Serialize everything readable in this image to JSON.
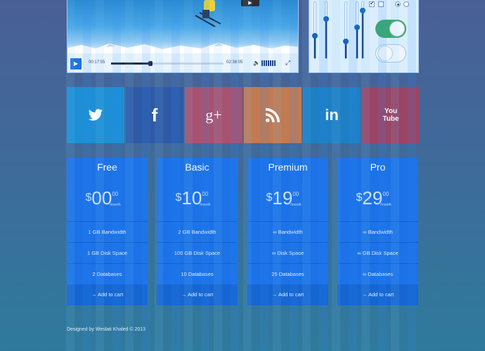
{
  "video": {
    "current_time": "00:17:55",
    "total_time": "02:38:05",
    "progress": 0.35,
    "play_glyph": "▶",
    "top_button_glyph": "▶",
    "volume_glyph": "🔈",
    "expand_glyph": "⤢"
  },
  "controls": {
    "checkbox_glyph": "✔",
    "sliders": [
      0.4,
      0.7,
      0.3,
      0.55,
      0.85
    ],
    "checkbox_checked": true,
    "radio_selected": true,
    "toggle_on": true,
    "toggle_off": false
  },
  "social": [
    {
      "name": "twitter",
      "color": "#1e8fd4",
      "glyph": "🐦"
    },
    {
      "name": "facebook",
      "color": "#2f5aa6",
      "glyph": "f"
    },
    {
      "name": "google-plus",
      "color": "#a85270",
      "glyph": "g+"
    },
    {
      "name": "rss",
      "color": "#c27a52",
      "glyph": ")))"
    },
    {
      "name": "linkedin",
      "color": "#1e7fc4",
      "glyph": "in"
    },
    {
      "name": "youtube",
      "color": "#9a4566",
      "glyph": "You Tube"
    }
  ],
  "pricing": [
    {
      "title": "Free",
      "currency": "$",
      "amount": "00",
      "cents": "00",
      "period": "/month",
      "features": [
        "1 GB Bandwidth",
        "1 GB Disk Space",
        "2 Databases"
      ],
      "cta": "Add to cart"
    },
    {
      "title": "Basic",
      "currency": "$",
      "amount": "10",
      "cents": "00",
      "period": "/month",
      "features": [
        "2 GB Bandwidth",
        "100 GB Disk Space",
        "10 Databases"
      ],
      "cta": "Add to cart"
    },
    {
      "title": "Premium",
      "currency": "$",
      "amount": "19",
      "cents": "00",
      "period": "/month",
      "features": [
        "∞ Bandwidth",
        "∞ Disk Space",
        "25 Databases"
      ],
      "cta": "Add to cart"
    },
    {
      "title": "Pro",
      "currency": "$",
      "amount": "29",
      "cents": "00",
      "period": "/month",
      "features": [
        "∞ Bandwidth",
        "∞ GB Disk Space",
        "∞ Databases"
      ],
      "cta": "Add to cart"
    }
  ],
  "cart_glyph": "→",
  "footer": "Designed by Weslati Khaled © 2013"
}
